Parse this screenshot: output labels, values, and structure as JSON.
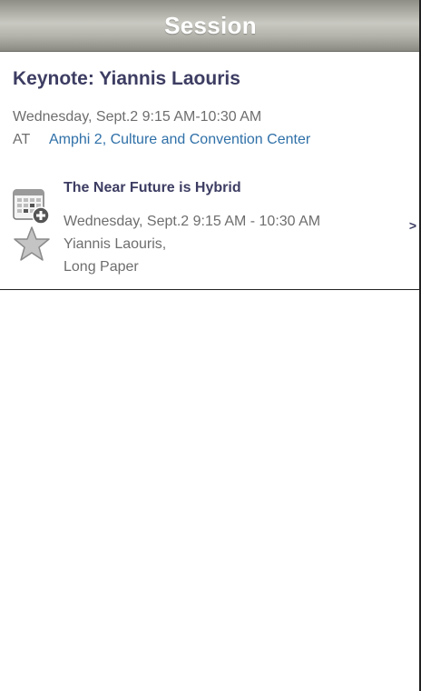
{
  "header": {
    "title": "Session"
  },
  "session": {
    "title": "Keynote: Yiannis Laouris",
    "time": "Wednesday, Sept.2 9:15 AM-10:30 AM",
    "at_label": "AT",
    "location": "Amphi 2, Culture and Convention Center"
  },
  "presentations": [
    {
      "title": "The Near Future is Hybrid",
      "time": "Wednesday, Sept.2 9:15 AM - 10:30 AM",
      "authors": "Yiannis Laouris,",
      "type": "Long Paper",
      "chevron": ">"
    }
  ],
  "icons": {
    "calendar": "calendar-add-icon",
    "favorite": "star-icon"
  },
  "colors": {
    "header_text": "#ffffff",
    "title": "#3d3d63",
    "link": "#2f70a8",
    "secondary_text": "#6e6e6e"
  }
}
